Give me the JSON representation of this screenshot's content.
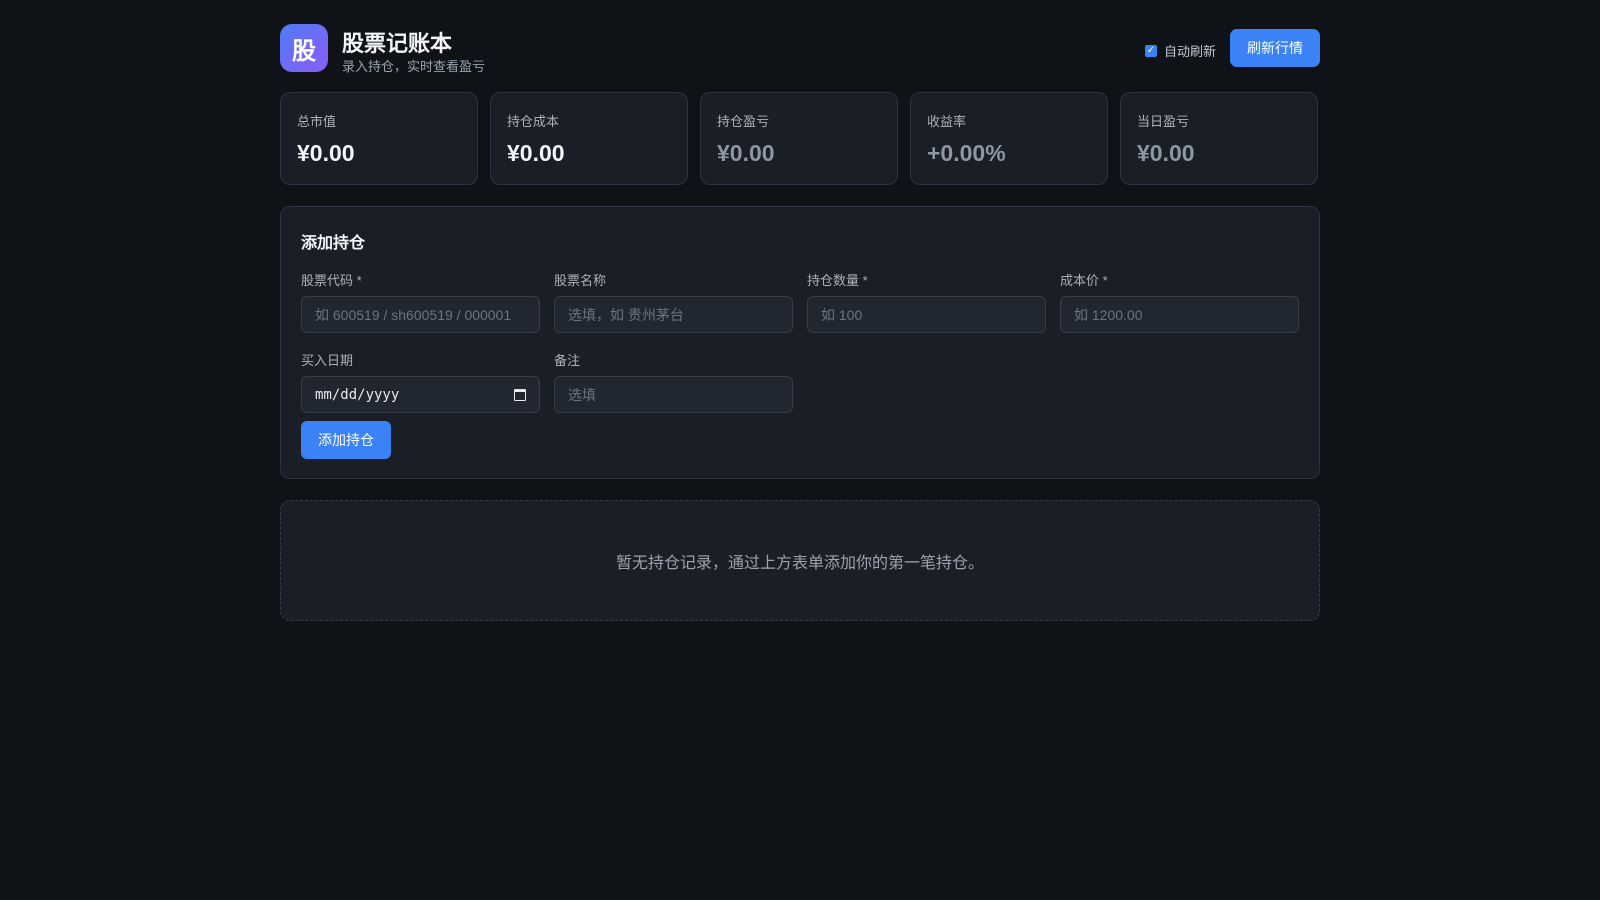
{
  "app": {
    "logo_char": "股",
    "title": "股票记账本",
    "subtitle": "录入持仓，实时查看盈亏",
    "auto_refresh_label": "自动刷新",
    "auto_refresh_checked": true,
    "refresh_button": "刷新行情"
  },
  "stats": [
    {
      "label": "总市值",
      "value": "¥0.00"
    },
    {
      "label": "持仓成本",
      "value": "¥0.00"
    },
    {
      "label": "持仓盈亏",
      "value": "¥0.00"
    },
    {
      "label": "收益率",
      "value": "+0.00%"
    },
    {
      "label": "当日盈亏",
      "value": "¥0.00"
    }
  ],
  "form": {
    "title": "添加持仓",
    "fields": {
      "code": {
        "label": "股票代码 *",
        "placeholder": "如 600519 / sh600519 / 000001"
      },
      "name": {
        "label": "股票名称",
        "placeholder": "选填，如 贵州茅台"
      },
      "qty": {
        "label": "持仓数量 *",
        "placeholder": "如 100"
      },
      "cost": {
        "label": "成本价 *",
        "placeholder": "如 1200.00"
      },
      "date": {
        "label": "买入日期",
        "value": "mm/dd/yyyy"
      },
      "note": {
        "label": "备注",
        "placeholder": "选填"
      }
    },
    "submit_label": "添加持仓"
  },
  "empty_state": "暂无持仓记录，通过上方表单添加你的第一笔持仓。",
  "colors": {
    "accent": "#3b82f6",
    "background": "#0f1318",
    "card": "#1a1f27"
  }
}
